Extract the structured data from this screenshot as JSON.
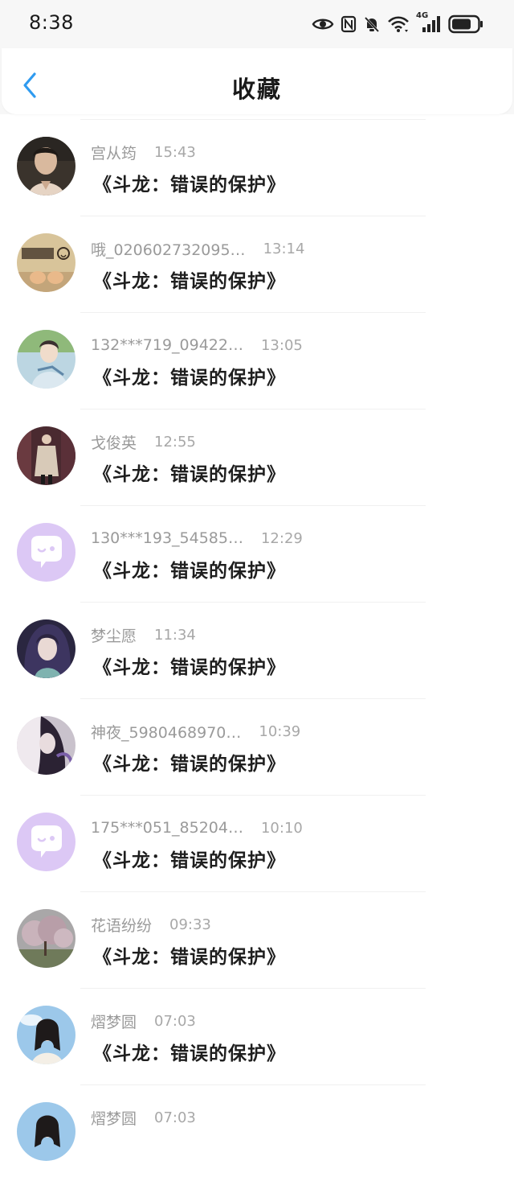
{
  "status_bar": {
    "time": "8:38",
    "icons": [
      "eye-icon",
      "nfc-icon",
      "bell-off-icon",
      "wifi-icon",
      "signal-4g-icon",
      "battery-icon"
    ],
    "network_label": "4G"
  },
  "header": {
    "title": "收藏",
    "back_icon": "chevron-left-icon",
    "accent_color": "#2f9bf0"
  },
  "items": [
    {
      "name": "宫从筠",
      "time": "15:43",
      "book": "《斗龙：错误的保护》",
      "avatar": "photo-person"
    },
    {
      "name": "哦_020602732095…",
      "time": "13:14",
      "book": "《斗龙：错误的保护》",
      "avatar": "photo-jiayou"
    },
    {
      "name": "132***719_09422…",
      "time": "13:05",
      "book": "《斗龙：错误的保护》",
      "avatar": "photo-anime-boy"
    },
    {
      "name": "戈俊英",
      "time": "12:55",
      "book": "《斗龙：错误的保护》",
      "avatar": "photo-coat"
    },
    {
      "name": "130***193_54585…",
      "time": "12:29",
      "book": "《斗龙：错误的保护》",
      "avatar": "default-chat-bubble-icon"
    },
    {
      "name": "梦尘愿",
      "time": "11:34",
      "book": "《斗龙：错误的保护》",
      "avatar": "photo-anime-girl"
    },
    {
      "name": "神夜_5980468970…",
      "time": "10:39",
      "book": "《斗龙：错误的保护》",
      "avatar": "photo-anime-dark"
    },
    {
      "name": "175***051_85204…",
      "time": "10:10",
      "book": "《斗龙：错误的保护》",
      "avatar": "default-chat-bubble-icon"
    },
    {
      "name": "花语纷纷",
      "time": "09:33",
      "book": "《斗龙：错误的保护》",
      "avatar": "photo-blossom-tree"
    },
    {
      "name": "熠梦圆",
      "time": "07:03",
      "book": "《斗龙：错误的保护》",
      "avatar": "photo-girl-sky"
    },
    {
      "name": "熠梦圆",
      "time": "07:03",
      "book": "",
      "avatar": "photo-girl-sky"
    }
  ],
  "colors": {
    "default_avatar_bg": "#dcc8f5",
    "default_avatar_fg": "#ffffff"
  }
}
